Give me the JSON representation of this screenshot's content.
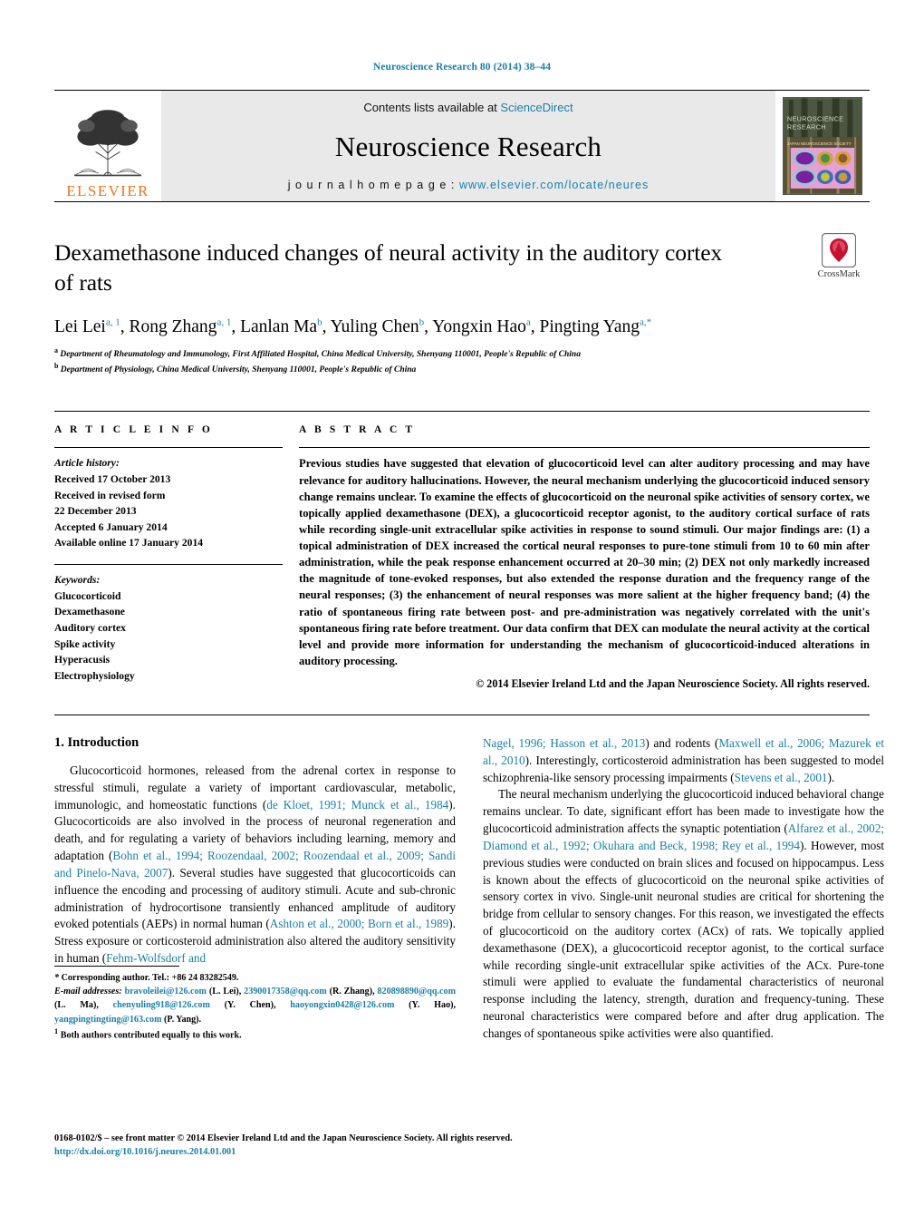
{
  "running_head": "Neuroscience Research 80 (2014) 38–44",
  "masthead": {
    "publisher_name": "ELSEVIER",
    "contents_line_prefix": "Contents lists available at ",
    "contents_link": "ScienceDirect",
    "journal_name": "Neuroscience Research",
    "homepage_prefix": "j o u r n a l   h o m e p a g e :   ",
    "homepage_url": "www.elsevier.com/locate/neures",
    "cover_title_line1": "NEUROSCIENCE",
    "cover_title_line2": "RESEARCH"
  },
  "article": {
    "title": "Dexamethasone induced changes of neural activity in the auditory cortex of rats",
    "crossmark_label": "CrossMark",
    "authors_html": "Lei Lei<sup>a, 1</sup>, Rong Zhang<sup>a, 1</sup>, Lanlan Ma<sup>b</sup>, Yuling Chen<sup>b</sup>, Yongxin Hao<sup>a</sup>, Pingting Yang<sup>a,*</sup>",
    "affiliation_a": "Department of Rheumatology and Immunology, First Affiliated Hospital, China Medical University, Shenyang 110001, People's Republic of China",
    "affiliation_b": "Department of Physiology, China Medical University, Shenyang 110001, People's Republic of China"
  },
  "article_info": {
    "heading": "A R T I C L E   I N F O",
    "history_label": "Article history:",
    "history": [
      "Received 17 October 2013",
      "Received in revised form",
      "22 December 2013",
      "Accepted 6 January 2014",
      "Available online 17 January 2014"
    ],
    "keywords_label": "Keywords:",
    "keywords": [
      "Glucocorticoid",
      "Dexamethasone",
      "Auditory cortex",
      "Spike activity",
      "Hyperacusis",
      "Electrophysiology"
    ]
  },
  "abstract": {
    "heading": "A B S T R A C T",
    "text": "Previous studies have suggested that elevation of glucocorticoid level can alter auditory processing and may have relevance for auditory hallucinations. However, the neural mechanism underlying the glucocorticoid induced sensory change remains unclear. To examine the effects of glucocorticoid on the neuronal spike activities of sensory cortex, we topically applied dexamethasone (DEX), a glucocorticoid receptor agonist, to the auditory cortical surface of rats while recording single-unit extracellular spike activities in response to sound stimuli. Our major findings are: (1) a topical administration of DEX increased the cortical neural responses to pure-tone stimuli from 10 to 60 min after administration, while the peak response enhancement occurred at 20–30 min; (2) DEX not only markedly increased the magnitude of tone-evoked responses, but also extended the response duration and the frequency range of the neural responses; (3) the enhancement of neural responses was more salient at the higher frequency band; (4) the ratio of spontaneous firing rate between post- and pre-administration was negatively correlated with the unit's spontaneous firing rate before treatment. Our data confirm that DEX can modulate the neural activity at the cortical level and provide more information for understanding the mechanism of glucocorticoid-induced alterations in auditory processing.",
    "copyright": "© 2014 Elsevier Ireland Ltd and the Japan Neuroscience Society. All rights reserved."
  },
  "introduction": {
    "heading": "1.  Introduction",
    "left_paragraph_1_html": "Glucocorticoid hormones, released from the adrenal cortex in response to stressful stimuli, regulate a variety of important cardiovascular, metabolic, immunologic, and homeostatic functions (<span class=\"blue\">de Kloet, 1991; Munck et al., 1984</span>). Glucocorticoids are also involved in the process of neuronal regeneration and death, and for regulating a variety of behaviors including learning, memory and adaptation (<span class=\"blue\">Bohn et al., 1994; Roozendaal, 2002; Roozendaal et al., 2009; Sandi and Pinelo-Nava, 2007</span>). Several studies have suggested that glucocorticoids can influence the encoding and processing of auditory stimuli. Acute and sub-chronic administration of hydrocortisone transiently enhanced amplitude of auditory evoked potentials (AEPs) in normal human (<span class=\"blue\">Ashton et al., 2000; Born et al., 1989</span>). Stress exposure or corticosteroid administration also altered the auditory sensitivity in human (<span class=\"blue\">Fehm-Wolfsdorf and</span>",
    "right_paragraph_1_html": "<span class=\"blue\">Nagel, 1996; Hasson et al., 2013</span>) and rodents (<span class=\"blue\">Maxwell et al., 2006; Mazurek et al., 2010</span>). Interestingly, corticosteroid administration has been suggested to model schizophrenia-like sensory processing impairments (<span class=\"blue\">Stevens et al., 2001</span>).",
    "right_paragraph_2_html": "The neural mechanism underlying the glucocorticoid induced behavioral change remains unclear. To date, significant effort has been made to investigate how the glucocorticoid administration affects the synaptic potentiation (<span class=\"blue\">Alfarez et al., 2002; Diamond et al., 1992; Okuhara and Beck, 1998; Rey et al., 1994</span>). However, most previous studies were conducted on brain slices and focused on hippocampus. Less is known about the effects of glucocorticoid on the neuronal spike activities of sensory cortex in vivo. Single-unit neuronal studies are critical for shortening the bridge from cellular to sensory changes. For this reason, we investigated the effects of glucocorticoid on the auditory cortex (ACx) of rats. We topically applied dexamethasone (DEX), a glucocorticoid receptor agonist, to the cortical surface while recording single-unit extracellular spike activities of the ACx. Pure-tone stimuli were applied to evaluate the fundamental characteristics of neuronal response including the latency, strength, duration and frequency-tuning. These neuronal characteristics were compared before and after drug application. The changes of spontaneous spike activities were also quantified."
  },
  "footnote": {
    "corresponding_html": "<span class=\"em\">*</span>  Corresponding author. Tel.: +86 24 83282549.",
    "emails_html": "<span class=\"em\">E-mail addresses:</span> <span class=\"blue\">bravoleilei@126.com</span> (L. Lei), <span class=\"blue\">2390017358@qq.com</span> (R. Zhang), <span class=\"blue\">820898890@qq.com</span> (L. Ma), <span class=\"blue\">chenyuling918@126.com</span> (Y. Chen), <span class=\"blue\">haoyongxin0428@126.com</span> (Y. Hao), <span class=\"blue\">yangpingtingting@163.com</span> (P. Yang).",
    "equal_contribution_html": "<sup>1</sup>  Both authors contributed equally to this work."
  },
  "page_footer": {
    "issn_line": "0168-0102/$ – see front matter © 2014 Elsevier Ireland Ltd and the Japan Neuroscience Society. All rights reserved.",
    "doi_line": "http://dx.doi.org/10.1016/j.neures.2014.01.001"
  },
  "colors": {
    "link_blue": "#1a7fa8",
    "elsevier_orange": "#E87722",
    "masthead_grey": "#e9e9e9",
    "crossmark_red": "#C8102E"
  }
}
